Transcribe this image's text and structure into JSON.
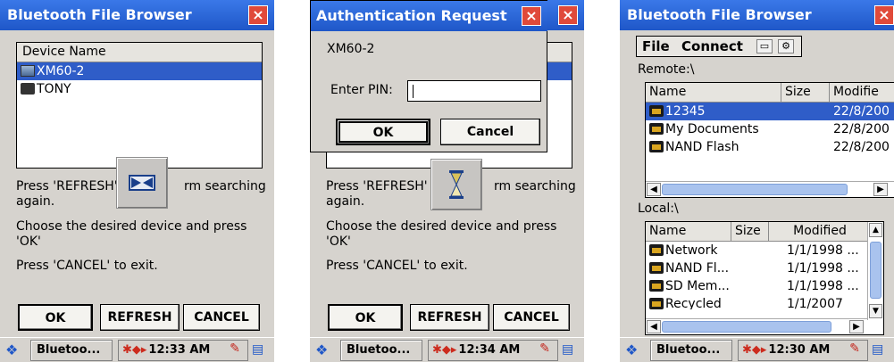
{
  "screen1": {
    "title": "Bluetooth File Browser",
    "close_label": "×",
    "list_header": "Device Name",
    "devices": [
      "XM60-2",
      "TONY"
    ],
    "msg_refresh_a": "Press 'REFRESH'",
    "msg_refresh_b": "rm searching",
    "msg_refresh_c": "again.",
    "msg_choose": "Choose the desired device and press 'OK'",
    "msg_exit": "Press 'CANCEL' to exit.",
    "ok": "OK",
    "refresh": "REFRESH",
    "cancel": "CANCEL",
    "taskbar_task": "Bluetoo...",
    "time": "12:33 AM"
  },
  "screen2": {
    "dialog_title": "Authentication Request",
    "device": "XM60-2",
    "pin_label": "Enter PIN:",
    "pin_value": "",
    "ok": "OK",
    "cancel": "Cancel",
    "msg_refresh_a": "Press 'REFRESH'",
    "msg_refresh_b": "rm searching",
    "msg_refresh_c": "again.",
    "msg_choose": "Choose the desired device and press 'OK'",
    "msg_exit": "Press 'CANCEL' to exit.",
    "btn_ok": "OK",
    "btn_refresh": "REFRESH",
    "btn_cancel": "CANCEL",
    "taskbar_task": "Bluetoo...",
    "time": "12:34 AM"
  },
  "screen3": {
    "title": "Bluetooth File Browser",
    "menu_file": "File",
    "menu_connect": "Connect",
    "remote_label": "Remote:\\",
    "remote_headers": {
      "name": "Name",
      "size": "Size",
      "modified": "Modifie"
    },
    "remote_rows": [
      {
        "name": "12345",
        "modified": "22/8/200"
      },
      {
        "name": "My Documents",
        "modified": "22/8/200"
      },
      {
        "name": "NAND Flash",
        "modified": "22/8/200"
      }
    ],
    "local_label": "Local:\\",
    "local_headers": {
      "name": "Name",
      "size": "Size",
      "modified": "Modified"
    },
    "local_rows": [
      {
        "name": "Network",
        "modified": "1/1/1998 ..."
      },
      {
        "name": "NAND Fl...",
        "modified": "1/1/1998 ..."
      },
      {
        "name": "SD Mem...",
        "modified": "1/1/1998 ..."
      },
      {
        "name": "Recycled",
        "modified": "1/1/2007"
      }
    ],
    "taskbar_task": "Bluetoo...",
    "time": "12:30 AM"
  },
  "icons": {
    "start": "windows-start-icon",
    "tray": "bluetooth-network-tray-icon",
    "keyboard": "input-panel-icon",
    "desktop": "show-desktop-icon",
    "busy": "hourglass-icon",
    "connect": "bluetooth-connect-icon"
  },
  "colors": {
    "titlebar": "#1f57c8",
    "selection": "#2f5dc8",
    "close": "#e04a3a"
  }
}
